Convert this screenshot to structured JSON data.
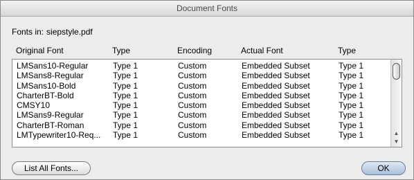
{
  "window": {
    "title": "Document Fonts"
  },
  "source": {
    "label": "Fonts in:",
    "filename": "siepstyle.pdf"
  },
  "table": {
    "columns": [
      "Original Font",
      "Type",
      "Encoding",
      "Actual Font",
      "Type"
    ],
    "rows": [
      [
        "LMSans10-Regular",
        "Type 1",
        "Custom",
        "Embedded Subset",
        "Type 1"
      ],
      [
        "LMSans8-Regular",
        "Type 1",
        "Custom",
        "Embedded Subset",
        "Type 1"
      ],
      [
        "LMSans10-Bold",
        "Type 1",
        "Custom",
        "Embedded Subset",
        "Type 1"
      ],
      [
        "CharterBT-Bold",
        "Type 1",
        "Custom",
        "Embedded Subset",
        "Type 1"
      ],
      [
        "CMSY10",
        "Type 1",
        "Custom",
        "Embedded Subset",
        "Type 1"
      ],
      [
        "LMSans9-Regular",
        "Type 1",
        "Custom",
        "Embedded Subset",
        "Type 1"
      ],
      [
        "CharterBT-Roman",
        "Type 1",
        "Custom",
        "Embedded Subset",
        "Type 1"
      ],
      [
        "LMTypewriter10-Req...",
        "Type 1",
        "Custom",
        "Embedded Subset",
        "Type 1"
      ]
    ]
  },
  "icons": {
    "scroll_up": "up-arrow-icon",
    "scroll_down": "down-arrow-icon"
  },
  "buttons": {
    "list_all": "List All Fonts...",
    "ok": "OK"
  }
}
